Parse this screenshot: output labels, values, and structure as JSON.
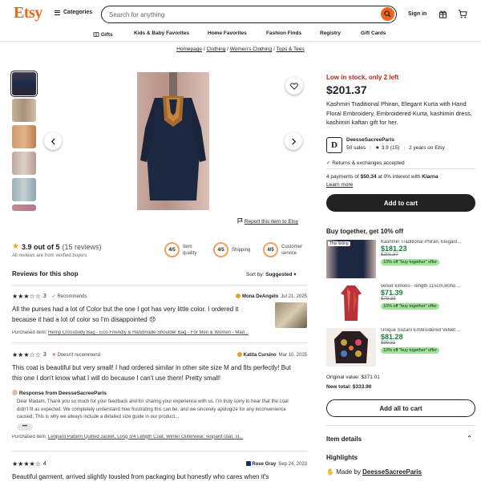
{
  "header": {
    "logo": "Etsy",
    "categories": "Categories",
    "search_placeholder": "Search for anything",
    "signin": "Sign in"
  },
  "nav": [
    "Gifts",
    "Kids & Baby Favorites",
    "Home Favorites",
    "Fashion Finds",
    "Registry",
    "Gift Cards"
  ],
  "breadcrumb": [
    "Homepage",
    "Clothing",
    "Women's Clothing",
    "Tops & Tees"
  ],
  "breadcrumb_sep": "/",
  "report": "Report this item to Etsy",
  "reviews_summary": {
    "rating": "3.9 out of 5",
    "count": "(15 reviews)",
    "verified": "All reviews are from verified buyers",
    "categories": [
      {
        "score": "4/5",
        "label": "Item quality"
      },
      {
        "score": "4/5",
        "label": "Shipping"
      },
      {
        "score": "4/5",
        "label": "Customer service"
      }
    ]
  },
  "reviews_header": {
    "title": "Reviews for this shop",
    "sort_label": "Sort by:",
    "sort_value": "Suggested"
  },
  "reviews": [
    {
      "stars": 3,
      "stars_label": "3",
      "tag": "Recommends",
      "user": "Mona DeAngelo",
      "date": "Jul 21, 2025",
      "text": "All the purses had a lot of Color but the one I got has very little color. I ordered it because it had a lot of color so I'm disappointed 😞",
      "purchased_label": "Purchased item:",
      "purchased": "Hemp Crossbody Bag - Eco-Friendly & Handmade Shoulder Bag - For Men & Women - Mad..."
    },
    {
      "stars": 3,
      "stars_label": "3",
      "tag": "Doesn't recommend",
      "user": "Katita Cursino",
      "date": "Mar 10, 2025",
      "text": "This coat is beautiful but very small! I had ordered similar in other site size M and fits perfectly! But this one I don't know what I will do because I can't use them! Pretty small!",
      "response_title": "Response from DeesseSacreeParis",
      "response": "Dear Madam, Thank you so much for your feedback and for sharing your experience with us. I'm truly sorry to hear that the coat didn't fit as expected. We completely understand how frustrating this can be, and we sincerely apologize for any inconvenience caused. This is why we always include a detailed size guide in our product...",
      "more": "•••",
      "purchased_label": "Purchased item:",
      "purchased": "Leopard Pattern Quilted Jacket, Long 3/4 Length Coat, Winter Outerwear, leopard coat, st..."
    },
    {
      "stars": 4,
      "stars_label": "4",
      "user": "Rose Gray",
      "date": "Sep 24, 2023",
      "text": "Beautiful garment, arrived slightly tousled from packaging but honestly who cares when it's"
    }
  ],
  "product": {
    "stock": "Low in stock, only 2 left",
    "price": "$201.37",
    "title": "Kashmiri Traditional Phiran, Elegant Kurta with Hand Floral Embroidery, Embroidered Kurta, kashimiri dress, kashimiri kaftan gift for her.",
    "shop_name": "DeesseSacreeParis",
    "sales": "50 sales",
    "shop_rating": "3.9",
    "shop_reviews": "(15)",
    "years": "2 years on Etsy",
    "returns": "Returns & exchanges accepted",
    "klarna_pre": "4 payments of",
    "klarna_amount": "$50.34",
    "klarna_mid": "at 0% interest with",
    "klarna_brand": "Klarna",
    "learn_more": "Learn more",
    "add_to_cart": "Add to cart"
  },
  "bundle": {
    "title": "Buy together, get 10% off",
    "items": [
      {
        "name": "Kashmiri Traditional Phiran, Elegant...",
        "price": "$181.23",
        "old": "$201.37",
        "badge": "10% off \"buy together\" offer",
        "listing": "This listing"
      },
      {
        "name": "velvet kimono - length 115cm,Boho ...",
        "price": "$71.39",
        "old": "$79.33",
        "badge": "10% off \"buy together\" offer"
      },
      {
        "name": "Unique Suzani Embroidered Velvet ...",
        "price": "$81.28",
        "old": "$90.31",
        "badge": "10% off \"buy together\" offer"
      }
    ],
    "original_label": "Original value:",
    "original": "$371.01",
    "new_label": "New total:",
    "new": "$333.90",
    "add_all": "Add all to cart"
  },
  "details": {
    "title": "Item details",
    "highlights": "Highlights",
    "made_by_label": "Made by",
    "made_by": "DeesseSacreeParis"
  },
  "colors": {
    "brand": "#f1641e",
    "dark": "#222222",
    "sale": "#1a7d3c",
    "stock": "#b3261e",
    "badge": "#9ee59a"
  }
}
